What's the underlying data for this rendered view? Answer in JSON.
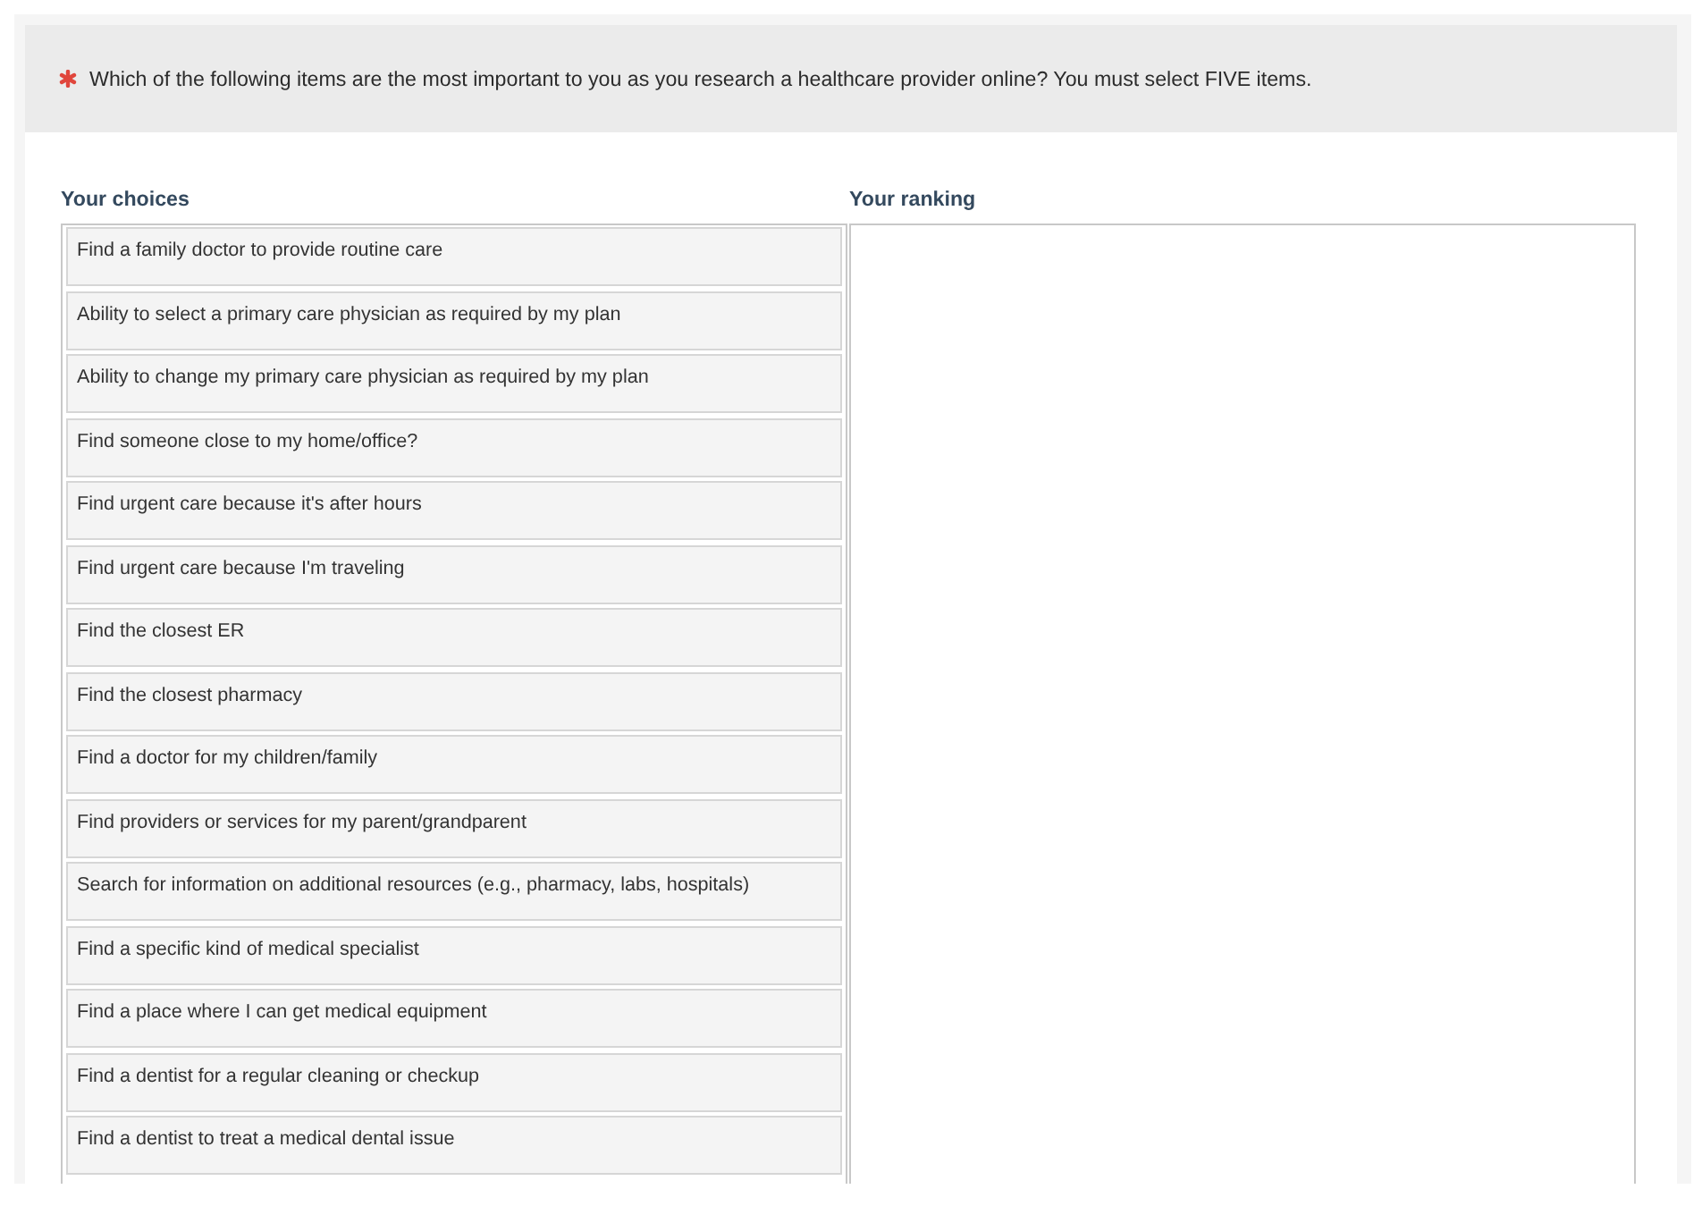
{
  "question": {
    "required": true,
    "text": "Which of the following items are the most important to you as you research a healthcare provider online? You must select FIVE items."
  },
  "choices": {
    "heading": "Your choices",
    "items": [
      "Find a family doctor to provide routine care",
      "Ability to select a primary care physician as required by my plan",
      "Ability to change my primary care physician as required by my plan",
      "Find someone close to my home/office?",
      "Find urgent care because it's after hours",
      "Find urgent care because I'm traveling",
      "Find the closest ER",
      "Find the closest pharmacy",
      "Find a doctor for my children/family",
      "Find providers or services for my parent/grandparent",
      "Search for information on additional resources (e.g., pharmacy, labs, hospitals)",
      "Find a specific kind of medical specialist",
      "Find a place where I can get medical equipment",
      "Find a dentist for a regular cleaning or checkup",
      "Find a dentist to treat a medical dental issue"
    ]
  },
  "ranking": {
    "heading": "Your ranking"
  }
}
